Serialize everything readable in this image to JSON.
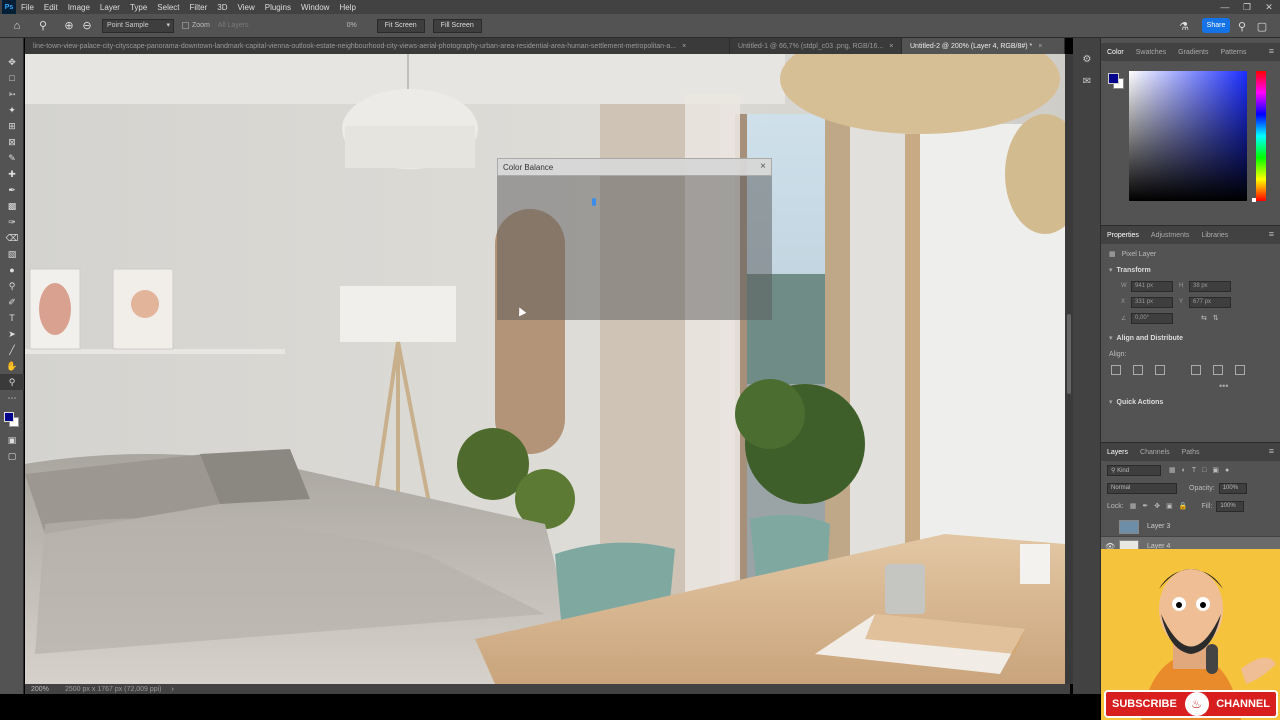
{
  "menu": {
    "logo": "Ps",
    "items": [
      "File",
      "Edit",
      "Image",
      "Layer",
      "Type",
      "Select",
      "Filter",
      "3D",
      "View",
      "Plugins",
      "Window",
      "Help"
    ]
  },
  "options": {
    "sample_select": "Point Sample",
    "zoom_check_label": "Zoom",
    "all_layers_label": "All Layers",
    "percent": "0%",
    "fit_screen": "Fit Screen",
    "fill_screen": "Fill Screen",
    "share": "Share"
  },
  "tabs": [
    {
      "label": "line-town-view-palace-city-cityscape-panorama-downtown-landmark-capital-vienna-outlook-estate-neighbourhood-city-views-aerial-photography-urban-area-residential-area-human-settlement-metropolitan-a...",
      "close": "×"
    },
    {
      "label": "Untitled-1 @ 66,7% (stdpl_c03 .png, RGB/16...",
      "close": "×"
    },
    {
      "label": "Untitled-2 @ 200% (Layer 4, RGB/8#) *",
      "close": "×"
    }
  ],
  "dialog": {
    "title": "Color Balance",
    "close": "×"
  },
  "status": {
    "zoom": "200%",
    "info": "2500 px x 1767 px (72,009 ppi)",
    "arrow": "›"
  },
  "colors": {
    "foreground": "#00008b",
    "background": "#ffffff",
    "accent": "#1473e6"
  },
  "color_panel": {
    "tabs": [
      "Color",
      "Swatches",
      "Gradients",
      "Patterns"
    ]
  },
  "properties": {
    "tabs": [
      "Properties",
      "Adjustments",
      "Libraries"
    ],
    "kind": "Pixel Layer",
    "transform_title": "Transform",
    "w_label": "W",
    "w": "941 px",
    "h_label": "H",
    "h": "38 px",
    "x_label": "X",
    "x": "331 px",
    "y_label": "Y",
    "y": "677 px",
    "angle": "0,00°",
    "align_title": "Align and Distribute",
    "align_label": "Align:",
    "more": "•••",
    "quick_title": "Quick Actions"
  },
  "layers": {
    "tabs": [
      "Layers",
      "Channels",
      "Paths"
    ],
    "filter": "Kind",
    "blend": "Normal",
    "opacity_label": "Opacity:",
    "opacity": "100%",
    "lock_label": "Lock:",
    "fill_label": "Fill:",
    "fill": "100%",
    "items": [
      {
        "name": "Layer 3",
        "visible": false
      },
      {
        "name": "Layer 4",
        "visible": true
      }
    ]
  },
  "youtube": {
    "subscribe": "SUBSCRIBE",
    "channel": "CHANNEL"
  }
}
